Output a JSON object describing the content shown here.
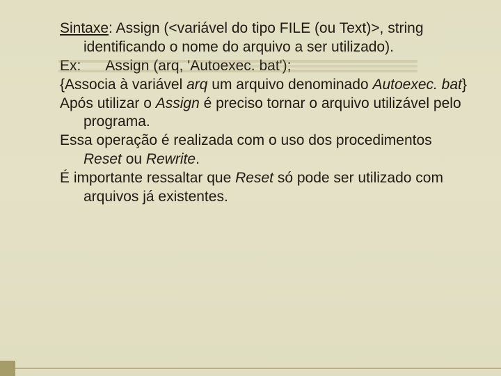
{
  "slide": {
    "lines": {
      "syntax_label": "Sintaxe",
      "syntax_body": ": Assign (<variável do tipo FILE (ou Text)>, string identificando o nome do arquivo a ser utilizado).",
      "example_label": "Ex:",
      "example_code": "Assign (arq, 'Autoexec. bat');",
      "assoc_open": "{Associa à variável ",
      "assoc_var": "arq",
      "assoc_mid": " um arquivo denominado ",
      "assoc_file": "Autoexec. bat",
      "assoc_close": "}",
      "after_assign_1": "Após utilizar o ",
      "after_assign_word": "Assign",
      "after_assign_2": " é preciso tornar o arquivo utilizável  pelo  programa.",
      "operation_1": "Essa operação é realizada com o uso dos procedimentos ",
      "operation_reset": "Reset",
      "operation_or": " ou ",
      "operation_rewrite": "Rewrite",
      "operation_end": ".",
      "important_1": "É importante ressaltar que ",
      "important_reset": "Reset",
      "important_2": " só pode ser utilizado com arquivos já existentes."
    }
  }
}
